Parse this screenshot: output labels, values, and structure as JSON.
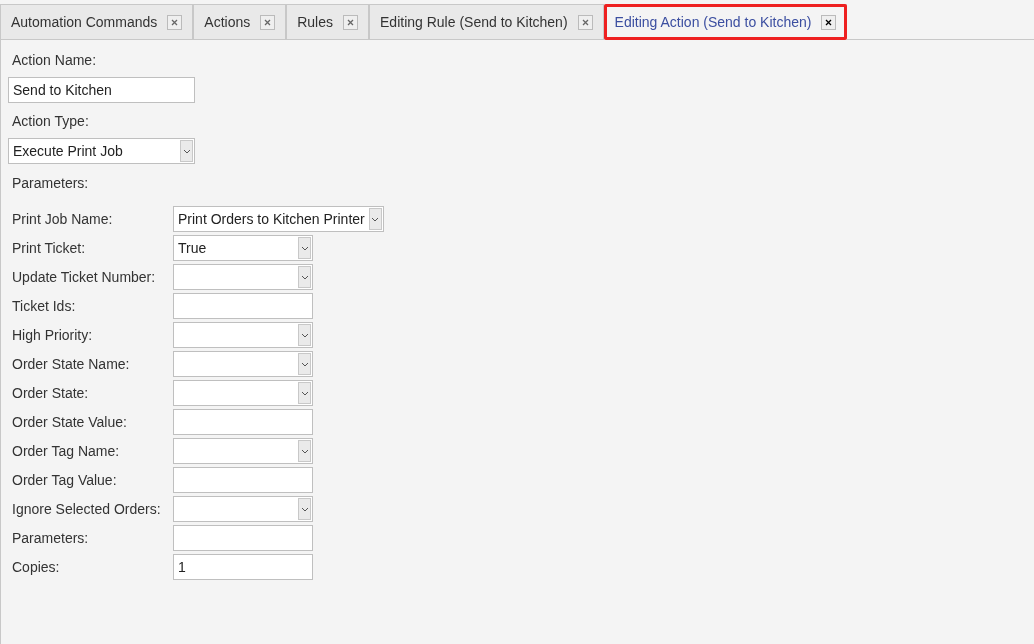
{
  "tabs": [
    {
      "label": "Automation Commands",
      "selected": false,
      "highlighted": false
    },
    {
      "label": "Actions",
      "selected": false,
      "highlighted": false
    },
    {
      "label": "Rules",
      "selected": false,
      "highlighted": false
    },
    {
      "label": "Editing Rule (Send to Kitchen)",
      "selected": false,
      "highlighted": false
    },
    {
      "label": "Editing Action (Send to Kitchen)",
      "selected": true,
      "highlighted": true
    }
  ],
  "action_name": {
    "label": "Action Name:",
    "value": "Send to Kitchen"
  },
  "action_type": {
    "label": "Action Type:",
    "value": "Execute Print Job"
  },
  "parameters_heading": "Parameters:",
  "parameters": [
    {
      "label": "Print Job Name:",
      "kind": "dropdown",
      "value": "Print Orders to Kitchen Printer"
    },
    {
      "label": "Print Ticket:",
      "kind": "dropdown",
      "value": "True"
    },
    {
      "label": "Update Ticket Number:",
      "kind": "dropdown"
    },
    {
      "label": "Ticket Ids:",
      "kind": "text"
    },
    {
      "label": "High Priority:",
      "kind": "dropdown"
    },
    {
      "label": "Order State Name:",
      "kind": "dropdown"
    },
    {
      "label": "Order State:",
      "kind": "dropdown"
    },
    {
      "label": "Order State Value:",
      "kind": "text"
    },
    {
      "label": "Order Tag Name:",
      "kind": "dropdown"
    },
    {
      "label": "Order Tag Value:",
      "kind": "text"
    },
    {
      "label": "Ignore Selected Orders:",
      "kind": "dropdown"
    },
    {
      "label": "Parameters:",
      "kind": "text"
    },
    {
      "label": "Copies:",
      "kind": "text",
      "value": "1"
    }
  ]
}
